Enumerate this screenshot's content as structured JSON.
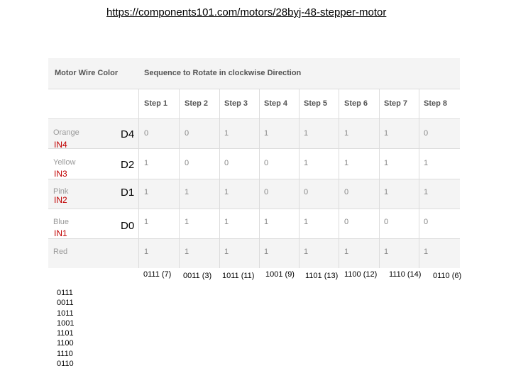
{
  "url": "https://components101.com/motors/28byj-48-stepper-motor",
  "table": {
    "motor_header": "Motor Wire Color",
    "sequence_header": "Sequence to Rotate in clockwise Direction",
    "steps": [
      "Step 1",
      "Step 2",
      "Step 3",
      "Step 4",
      "Step 5",
      "Step 6",
      "Step 7",
      "Step 8"
    ],
    "rows": [
      {
        "wire": "Orange",
        "input": "IN4",
        "pin": "D4",
        "values": [
          "0",
          "0",
          "1",
          "1",
          "1",
          "1",
          "1",
          "0"
        ]
      },
      {
        "wire": "Yellow",
        "input": "IN3",
        "pin": "D2",
        "values": [
          "1",
          "0",
          "0",
          "0",
          "1",
          "1",
          "1",
          "1"
        ]
      },
      {
        "wire": "Pink",
        "input": "IN2",
        "pin": "D1",
        "values": [
          "1",
          "1",
          "1",
          "0",
          "0",
          "0",
          "1",
          "1"
        ]
      },
      {
        "wire": "Blue",
        "input": "IN1",
        "pin": "D0",
        "values": [
          "1",
          "1",
          "1",
          "1",
          "1",
          "0",
          "0",
          "0"
        ]
      },
      {
        "wire": "Red",
        "input": "",
        "pin": "",
        "values": [
          "1",
          "1",
          "1",
          "1",
          "1",
          "1",
          "1",
          "1"
        ]
      }
    ]
  },
  "step_results": [
    "0111 (7)",
    "0011 (3)",
    "1011 (11)",
    "1001 (9)",
    "1101 (13)",
    "1100 (12)",
    "1110 (14)",
    "0110 (6)"
  ],
  "binary_list": [
    "0111",
    "0011",
    "1011",
    "1001",
    "1101",
    "1100",
    "1110",
    "0110"
  ]
}
